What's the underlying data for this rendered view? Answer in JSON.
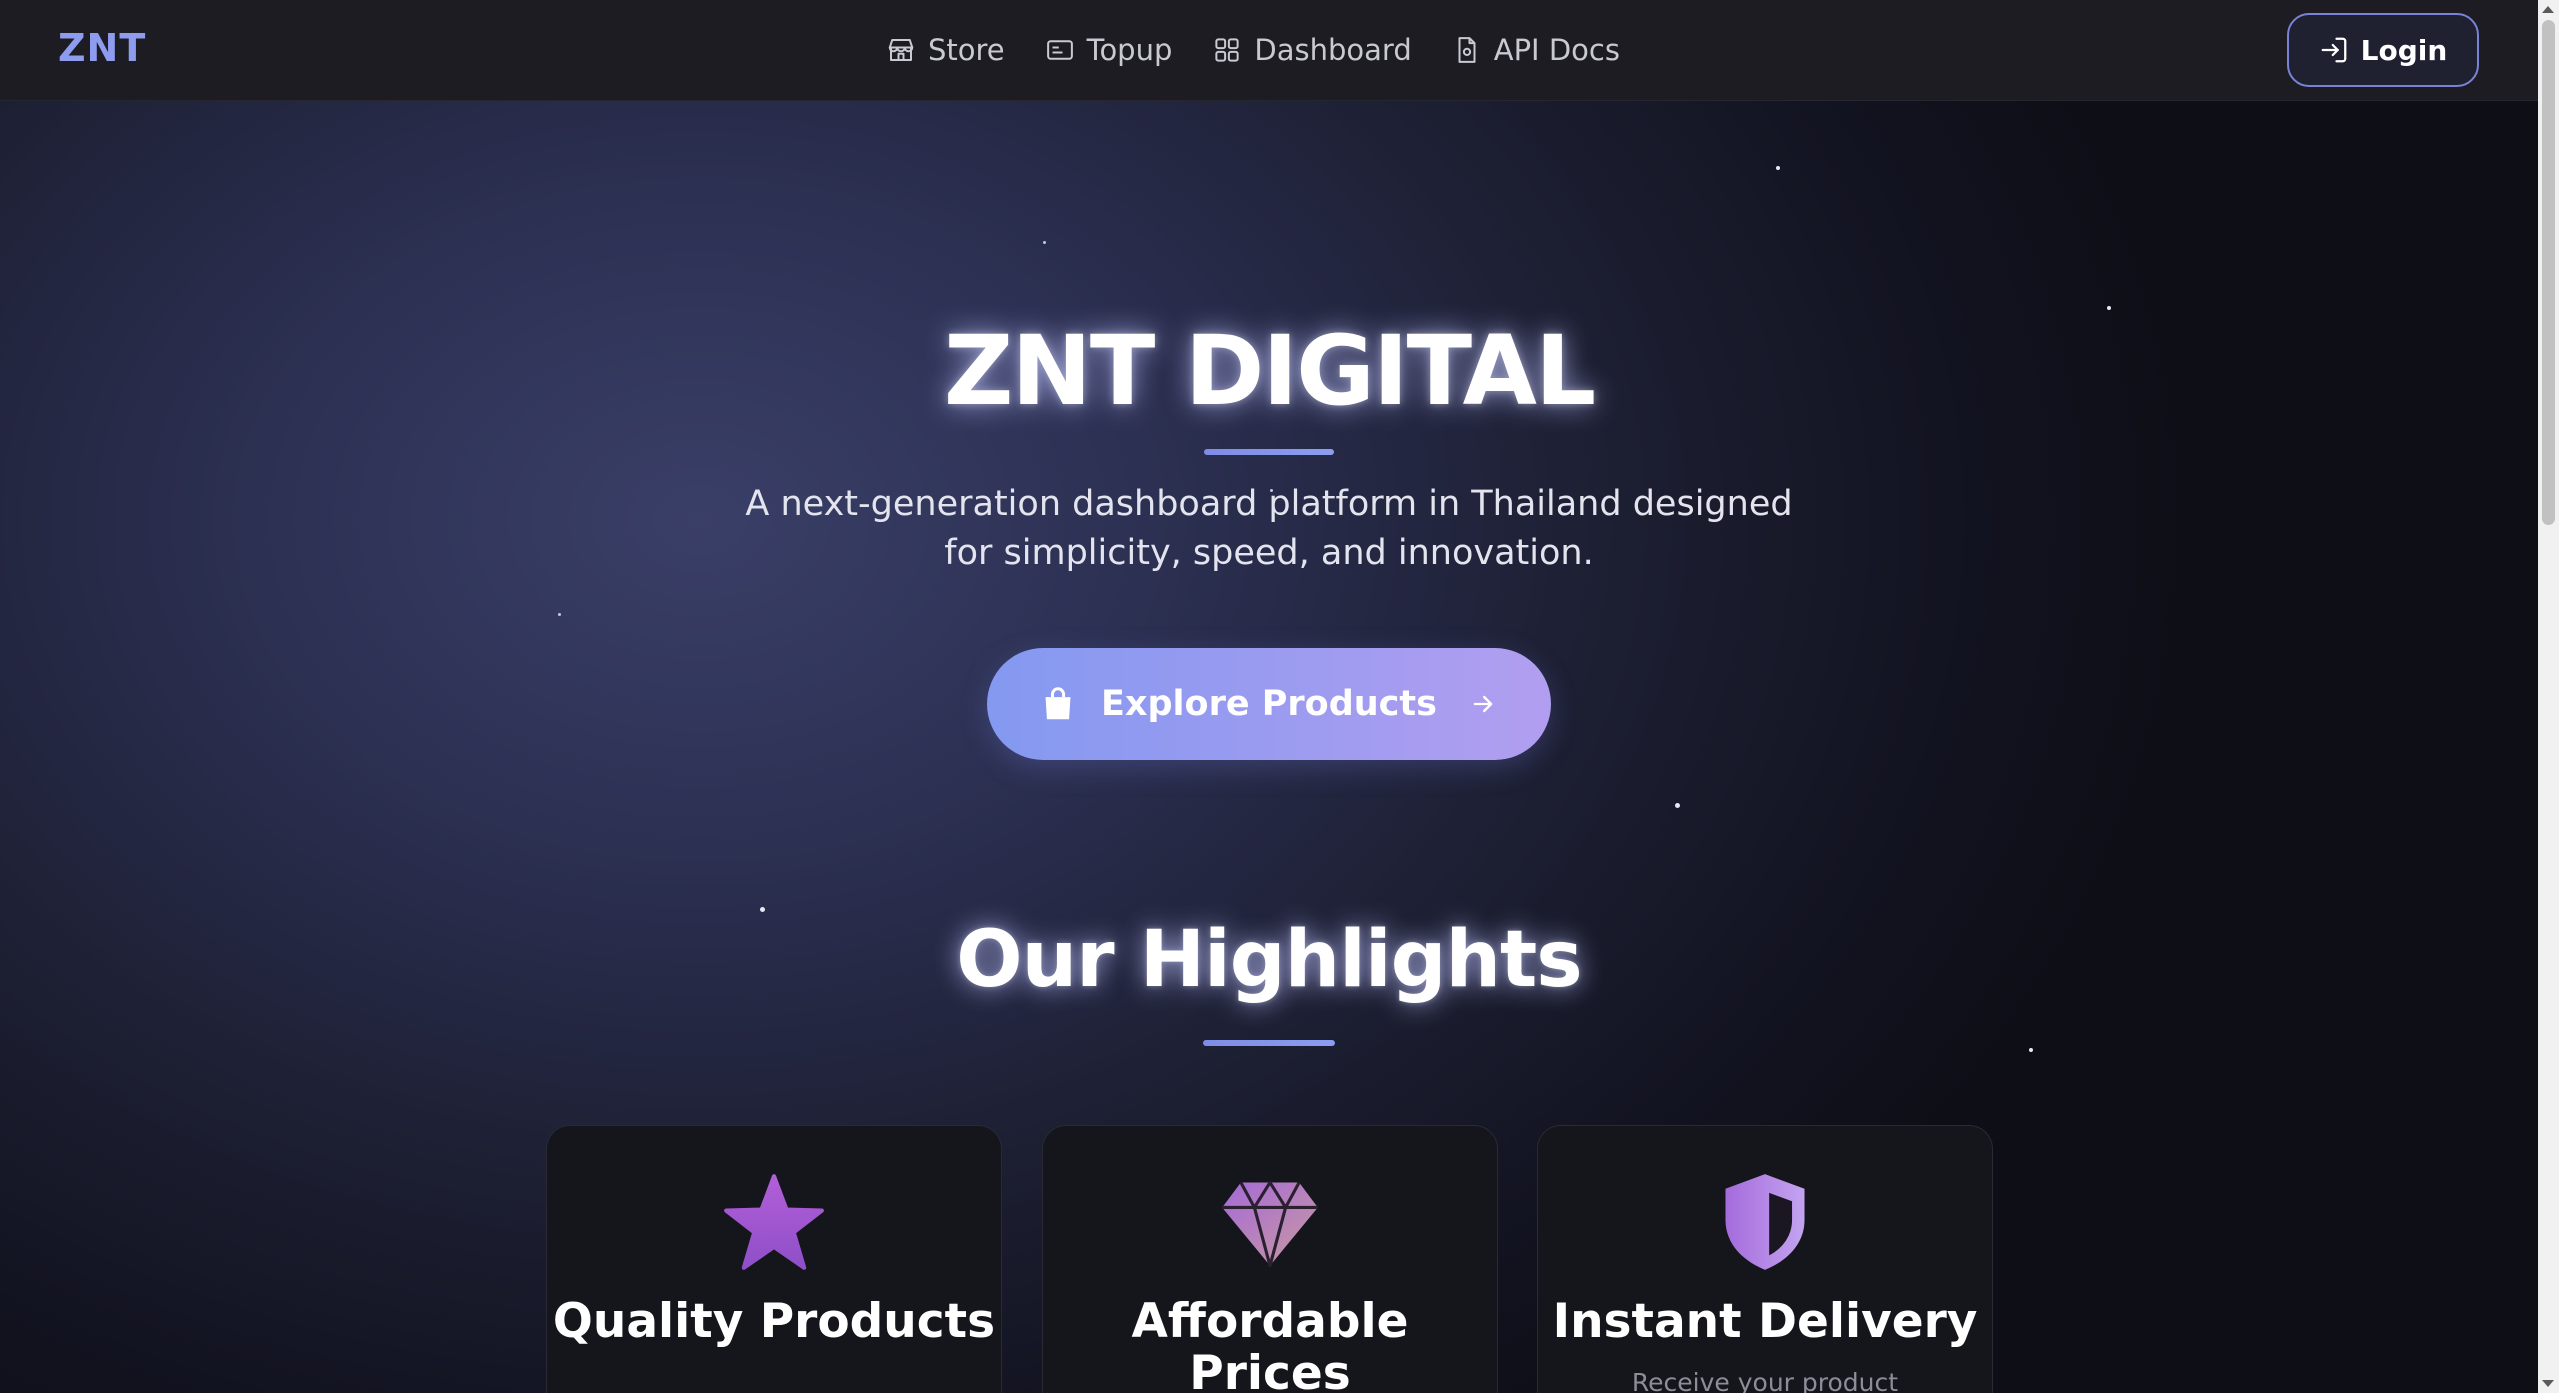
{
  "navbar": {
    "brand": "ZNT",
    "links": [
      {
        "label": "Store",
        "icon": "store-icon"
      },
      {
        "label": "Topup",
        "icon": "card-icon"
      },
      {
        "label": "Dashboard",
        "icon": "grid-icon"
      },
      {
        "label": "API Docs",
        "icon": "document-icon"
      }
    ],
    "login_label": "Login"
  },
  "hero": {
    "title": "ZNT DIGITAL",
    "subtitle_line1": "A next-generation dashboard platform in Thailand designed",
    "subtitle_line2": "for simplicity, speed, and innovation.",
    "cta_label": "Explore Products"
  },
  "highlights": {
    "title": "Our Highlights",
    "cards": [
      {
        "title": "Quality Products",
        "icon": "star-icon",
        "description": ""
      },
      {
        "title": "Affordable Prices",
        "icon": "diamond-icon",
        "description": ""
      },
      {
        "title": "Instant Delivery",
        "icon": "shield-icon",
        "description": "Receive your product"
      }
    ]
  },
  "colors": {
    "accent": "#8e9cf0",
    "button_gradient_start": "#8499f0",
    "button_gradient_end": "#b29ef0",
    "navbar_bg": "#1c1c22",
    "card_bg": "#15151c"
  }
}
